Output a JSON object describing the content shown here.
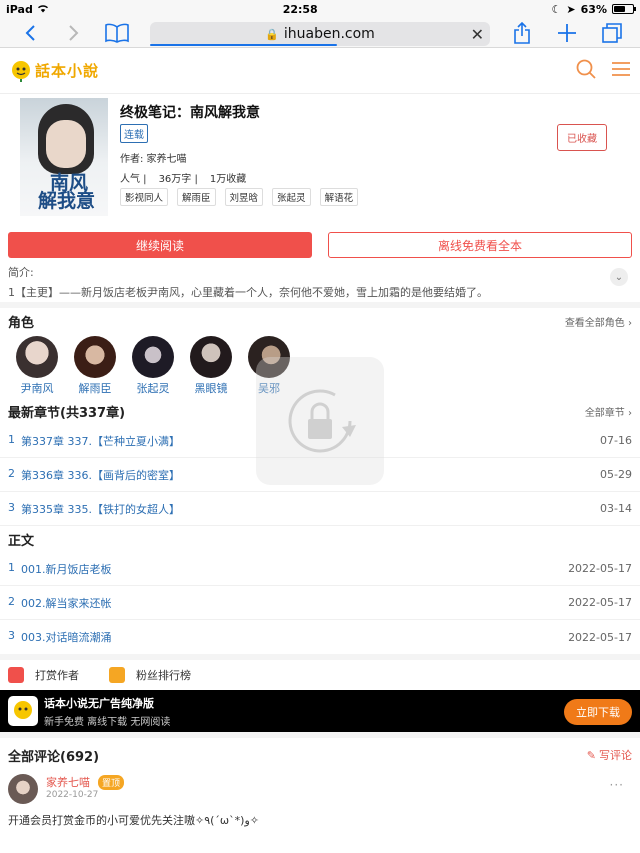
{
  "status": {
    "device": "iPad",
    "time": "22:58",
    "battery": "63%",
    "battery_level": 0.63
  },
  "browser": {
    "url": "ihuaben.com",
    "load_progress": 0.55
  },
  "site": {
    "logo_text": "話本小說"
  },
  "book": {
    "title": "终极笔记：南风解我意",
    "status_tag": "连载",
    "author": "作者: 家养七喵",
    "stats": [
      "人气 |",
      "36万字 |",
      "1万收藏"
    ],
    "tags": [
      "影视同人",
      "解雨臣",
      "刘昱晗",
      "张起灵",
      "解语花"
    ],
    "favorite_label": "已收藏",
    "cover_title_1": "南风",
    "cover_title_2": "解我意",
    "read_button": "继续阅读",
    "offline_button": "离线免费看全本",
    "intro_label": "简介:",
    "intro_text": "1【主更】——新月饭店老板尹南风，心里藏着一个人，奈何他不爱她，雪上加霜的是他要结婚了。"
  },
  "roles": {
    "title": "角色",
    "link": "查看全部角色 ›",
    "items": [
      {
        "name": "尹南风"
      },
      {
        "name": "解雨臣"
      },
      {
        "name": "张起灵"
      },
      {
        "name": "黑眼镜"
      },
      {
        "name": "吴邪"
      }
    ]
  },
  "latest": {
    "title": "最新章节(共337章)",
    "link": "全部章节 ›",
    "items": [
      {
        "idx": "1",
        "label": "第337章 337.【芒种立夏小满】",
        "date": "07-16"
      },
      {
        "idx": "2",
        "label": "第336章 336.【画背后的密室】",
        "date": "05-29"
      },
      {
        "idx": "3",
        "label": "第335章 335.【铁打的女超人】",
        "date": "03-14"
      }
    ]
  },
  "body": {
    "title": "正文",
    "items": [
      {
        "idx": "1",
        "label": "001.新月饭店老板",
        "date": "2022-05-17"
      },
      {
        "idx": "2",
        "label": "002.解当家来还帐",
        "date": "2022-05-17"
      },
      {
        "idx": "3",
        "label": "003.对话暗流潮涌",
        "date": "2022-05-17"
      }
    ]
  },
  "actions": {
    "tip_author": "打赏作者",
    "fan_rank": "粉丝排行榜"
  },
  "app_banner": {
    "title": "话本小说无广告纯净版",
    "subtitle": "新手免费 离线下载 无网阅读",
    "download": "立即下载"
  },
  "comments": {
    "title": "全部评论(692)",
    "write": "写评论",
    "first": {
      "name": "家养七喵",
      "badge": "置顶",
      "date": "2022-10-27",
      "more": "···",
      "text": "开通会员打赏金币的小可爱优先关注嗷✧٩(ˊωˋ*)و✧"
    }
  },
  "colors": {
    "accent": "#f0504b",
    "link": "#2d6fb3",
    "download": "#f07a18"
  }
}
